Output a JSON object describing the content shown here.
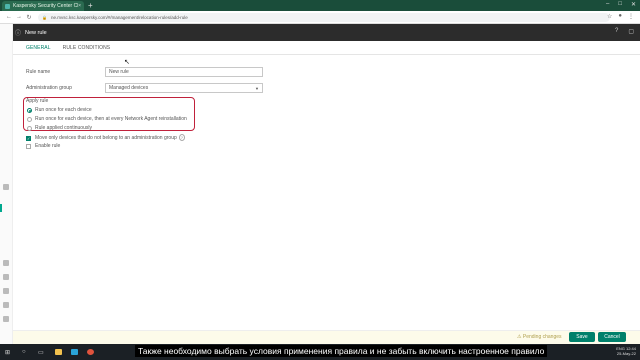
{
  "browser": {
    "tab_title": "Kaspersky Security Center Cloud ...",
    "tab_close": "×",
    "new_tab": "+",
    "url": "ne.mvsc.ksc.kaspersky.com/#/management/relocation-rules/add-rule"
  },
  "header": {
    "title": "New rule"
  },
  "tabs": [
    {
      "label": "GENERAL"
    },
    {
      "label": "RULE CONDITIONS"
    }
  ],
  "form": {
    "rule_name_label": "Rule name",
    "rule_name_placeholder": "New rule",
    "admin_group_label": "Administration group",
    "admin_group_value": "Managed devices",
    "apply_rule_legend": "Apply rule",
    "options": [
      {
        "label": "Run once for each device",
        "selected": true
      },
      {
        "label": "Run once for each device, then at every Network Agent reinstallation",
        "selected": false
      },
      {
        "label": "Rule applied continuously",
        "selected": false
      }
    ],
    "move_only_label": "Move only devices that do not belong to an administration group",
    "move_only_checked": true,
    "enable_rule_label": "Enable rule",
    "enable_rule_checked": false
  },
  "footer": {
    "pending": "⚠ Pending changes",
    "save": "Save",
    "cancel": "Cancel"
  },
  "subtitle": "Также необходимо выбрать условия применения правила и не забыть включить настроенное правило",
  "taskbar": {
    "time": "12:44",
    "date": "25-May-22",
    "lang": "ENG"
  },
  "colors": {
    "accent": "#00806b",
    "highlight": "#c0213b"
  }
}
